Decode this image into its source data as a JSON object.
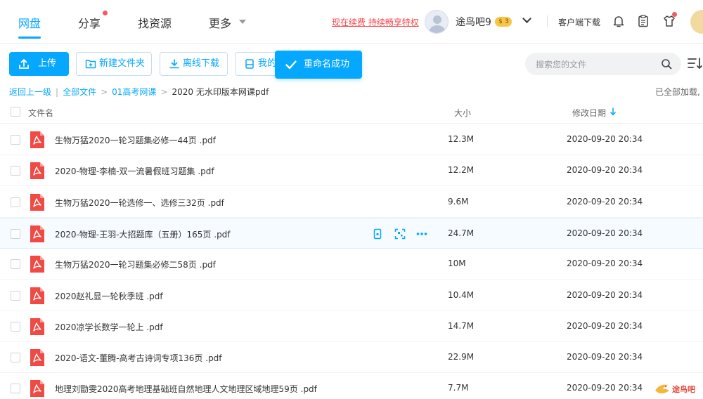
{
  "nav": {
    "items": [
      {
        "label": "网盘",
        "active": true
      },
      {
        "label": "分享",
        "active": false
      },
      {
        "label": "找资源",
        "active": false
      },
      {
        "label": "更多",
        "active": false
      }
    ],
    "promo": "现在续费 持续畅享特权",
    "username": "途鸟吧9",
    "vip_level": "3",
    "client_download": "客户端下载"
  },
  "toolbar": {
    "upload": "上传",
    "new_folder": "新建文件夹",
    "offline_download": "离线下载",
    "my_partial": "我的",
    "toast": "重命名成功",
    "search_placeholder": "搜索您的文件"
  },
  "breadcrumb": {
    "back": "返回上一级",
    "all_files": "全部文件",
    "folder": "01高考网课",
    "current": "2020 无水印版本网课pdf",
    "loaded_status": "已全部加载,"
  },
  "table": {
    "columns": {
      "name": "文件名",
      "size": "大小",
      "date": "修改日期"
    },
    "sorted_by": "修改日期",
    "rows": [
      {
        "name": "生物万猛2020一轮习题集必修一44页 .pdf",
        "size": "12.3M",
        "date": "2020-09-20 20:34"
      },
      {
        "name": "2020-物理-李楠-双一流暑假班习题集 .pdf",
        "size": "12.2M",
        "date": "2020-09-20 20:34"
      },
      {
        "name": "生物万猛2020一轮选修一、选修三32页 .pdf",
        "size": "9.6M",
        "date": "2020-09-20 20:34"
      },
      {
        "name": "2020-物理-王羽-大招题库（五册）165页 .pdf",
        "size": "24.7M",
        "date": "2020-09-20 20:34"
      },
      {
        "name": "生物万猛2020一轮习题集必修二58页 .pdf",
        "size": "10M",
        "date": "2020-09-20 20:34"
      },
      {
        "name": "2020赵礼显一轮秋季班 .pdf",
        "size": "10.4M",
        "date": "2020-09-20 20:34"
      },
      {
        "name": "2020凉学长数学一轮上 .pdf",
        "size": "14.7M",
        "date": "2020-09-20 20:34"
      },
      {
        "name": "2020-语文-董腾-高考古诗词专项136页 .pdf",
        "size": "22.9M",
        "date": "2020-09-20 20:34"
      },
      {
        "name": "地理刘勖雯2020高考地理基础班自然地理人文地理区域地理59页 .pdf",
        "size": "7.7M",
        "date": "2020-09-20 20:34"
      }
    ]
  },
  "watermark": {
    "text": "途鸟吧"
  },
  "colors": {
    "accent": "#06a7ff",
    "pdf_red": "#ef4a44",
    "promo_red": "#f5464b"
  },
  "icons": [
    "upload-icon",
    "new-folder-icon",
    "download-icon",
    "check-icon",
    "search-icon",
    "sort-list-icon",
    "bell-icon",
    "clipboard-icon",
    "tshirt-icon",
    "pdf-icon",
    "phone-icon",
    "qr-icon",
    "more-icon"
  ]
}
